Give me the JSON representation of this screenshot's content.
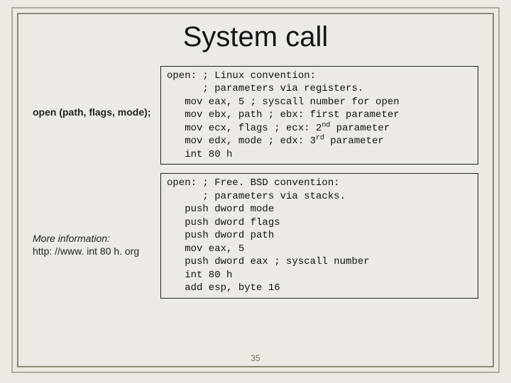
{
  "title": "System call",
  "left": {
    "open_call": "open (path, flags, mode);",
    "more_info_label": "More information:",
    "more_info_url": "http: //www. int 80 h. org"
  },
  "code1": {
    "l1": "open: ; Linux convention:",
    "l2": "      ; parameters via registers.",
    "l3": "   mov eax, 5 ; syscall number for open",
    "l4": "   mov ebx, path ; ebx: first parameter",
    "l5a": "   mov ecx, flags ; ecx: 2",
    "l5b": " parameter",
    "sup5": "nd",
    "l6a": "   mov edx, mode ; edx: 3",
    "l6b": " parameter",
    "sup6": "rd",
    "l7": "   int 80 h"
  },
  "code2": {
    "l1": "open: ; Free. BSD convention:",
    "l2": "      ; parameters via stacks.",
    "l3": "   push dword mode",
    "l4": "   push dword flags",
    "l5": "   push dword path",
    "l6": "   mov eax, 5",
    "l7": "   push dword eax ; syscall number",
    "l8": "   int 80 h",
    "l9": "   add esp, byte 16"
  },
  "slide_number": "35"
}
